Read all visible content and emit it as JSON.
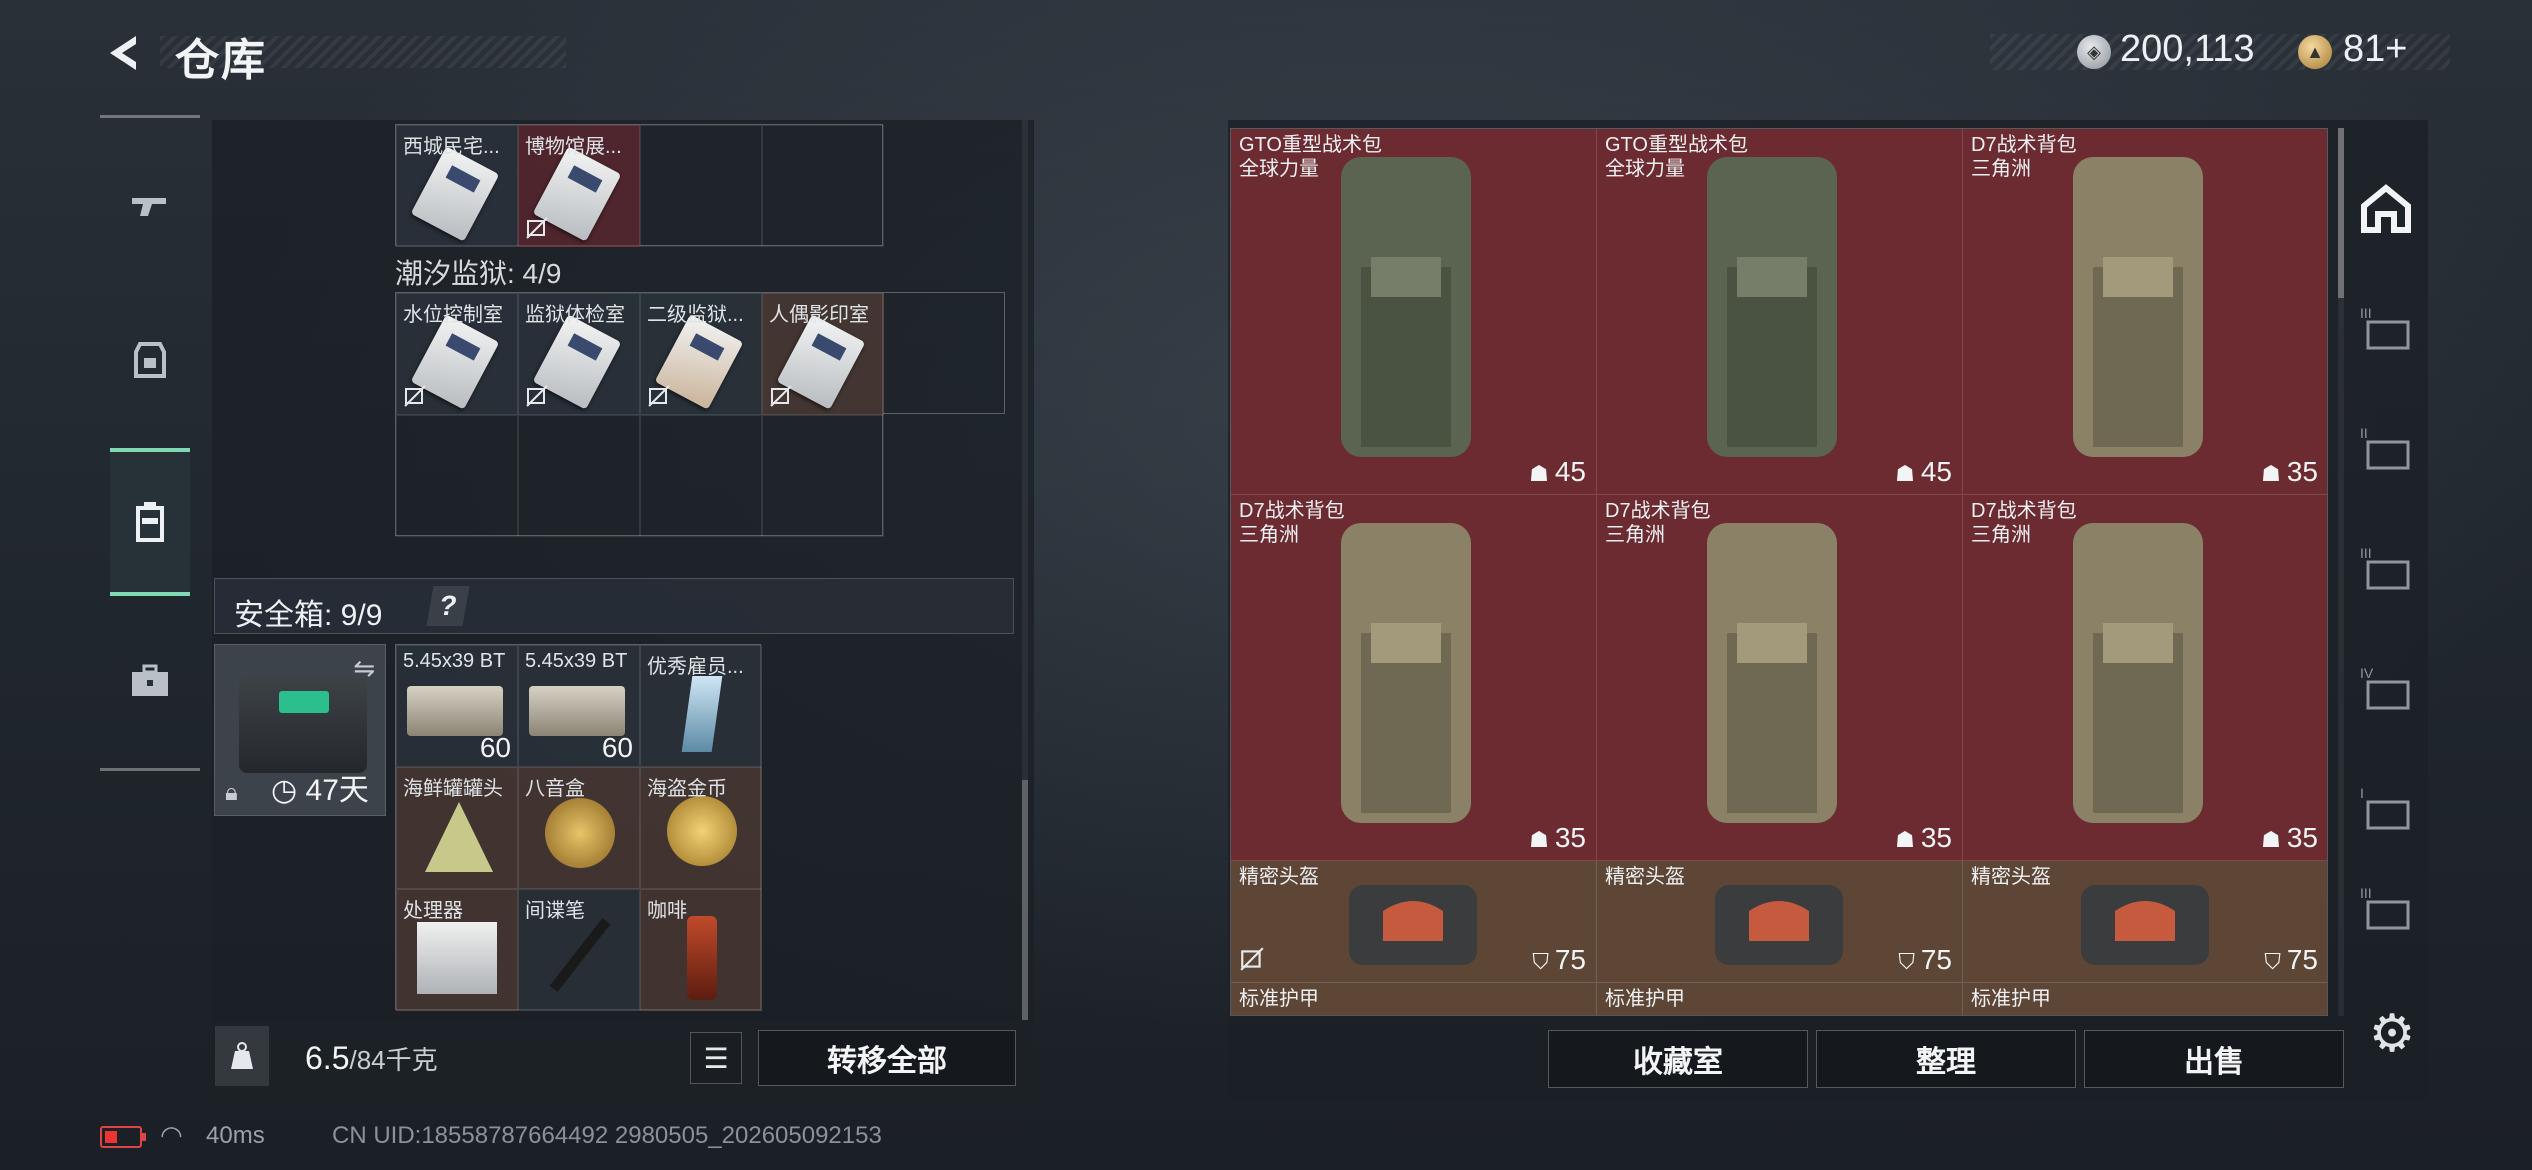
{
  "header": {
    "title": "仓库",
    "currency_main": "200,113",
    "currency_premium": "81+"
  },
  "left_tabs": [
    "gun-icon",
    "armor-icon",
    "backpack-icon",
    "toolbox-icon"
  ],
  "stash": {
    "top_row": [
      {
        "name": "西城民宅...",
        "color": "dark"
      },
      {
        "name": "博物馆展...",
        "color": "red"
      }
    ],
    "tidal_prison": {
      "label": "潮汐监狱: 4/9",
      "items": [
        {
          "name": "水位控制室"
        },
        {
          "name": "监狱体检室"
        },
        {
          "name": "二级监狱..."
        },
        {
          "name": "人偶影印室"
        }
      ]
    },
    "safe_box": {
      "label": "安全箱: 9/9",
      "help": "?",
      "timer": "47天",
      "items": [
        {
          "name": "5.45x39 BT",
          "count": "60",
          "color": "dark"
        },
        {
          "name": "5.45x39 BT",
          "count": "60",
          "color": "dark"
        },
        {
          "name": "优秀雇员...",
          "count": "",
          "color": "dark"
        },
        {
          "name": "海鲜罐罐头",
          "count": "",
          "color": "brown"
        },
        {
          "name": "八音盒",
          "count": "",
          "color": "brown"
        },
        {
          "name": "海盗金币",
          "count": "",
          "color": "brown"
        },
        {
          "name": "处理器",
          "count": "",
          "color": "brown"
        },
        {
          "name": "间谍笔",
          "count": "",
          "color": "dark"
        },
        {
          "name": "咖啡",
          "count": "",
          "color": "brown"
        }
      ]
    },
    "weight_current": "6.5",
    "weight_max": "/84千克",
    "transfer_all": "转移全部"
  },
  "container": {
    "items": [
      {
        "name": "GTO重型战术包",
        "sub": "全球力量",
        "value": "45",
        "color": "red"
      },
      {
        "name": "GTO重型战术包",
        "sub": "全球力量",
        "value": "45",
        "color": "red"
      },
      {
        "name": "D7战术背包",
        "sub": "三角洲",
        "value": "35",
        "color": "red"
      },
      {
        "name": "D7战术背包",
        "sub": "三角洲",
        "value": "35",
        "color": "red"
      },
      {
        "name": "D7战术背包",
        "sub": "三角洲",
        "value": "35",
        "color": "red"
      },
      {
        "name": "D7战术背包",
        "sub": "三角洲",
        "value": "35",
        "color": "red"
      }
    ],
    "helmets": [
      {
        "name": "精密头盔",
        "value": "75"
      },
      {
        "name": "精密头盔",
        "value": "75"
      },
      {
        "name": "精密头盔",
        "value": "75"
      }
    ],
    "armor_label": "标准护甲",
    "buttons": {
      "collection": "收藏室",
      "sort": "整理",
      "sell": "出售"
    }
  },
  "status": {
    "ping": "40ms",
    "uid": "CN UID:18558787664492 2980505_202605092153"
  },
  "colors": {
    "accent": "#7fd9b2",
    "red_cell": "#6c2a31",
    "brown_cell": "#5e4636"
  }
}
